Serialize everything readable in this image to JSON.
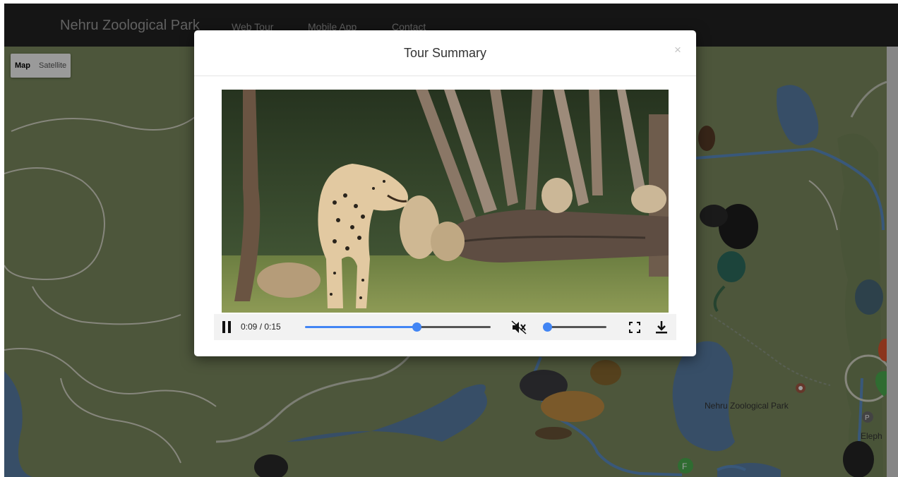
{
  "navbar": {
    "brand": "Nehru Zoological Park",
    "links": [
      "Web Tour",
      "Mobile App",
      "Contact"
    ]
  },
  "map": {
    "type_control": {
      "map_label": "Map",
      "satellite_label": "Satellite",
      "selected": "Map"
    },
    "place_label": "Nehru Zoological Park",
    "partial_label": "Eleph"
  },
  "modal": {
    "title": "Tour Summary",
    "close_glyph": "×",
    "video": {
      "time_display": "0:09 / 0:15",
      "progress_fraction": 0.6,
      "volume_fraction": 0.0,
      "muted": true,
      "playing": true
    }
  },
  "colors": {
    "navbar": "#222222",
    "accent": "#4285f4",
    "map_land": "#7c8b5f",
    "map_water": "#5a7fa6"
  },
  "icons": [
    "pause-icon",
    "mute-icon",
    "fullscreen-icon",
    "download-icon",
    "close-icon"
  ]
}
